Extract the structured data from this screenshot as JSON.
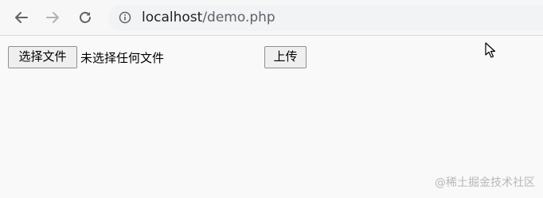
{
  "browser": {
    "address_bar": {
      "host": "localhost",
      "path": "/demo.php"
    },
    "icons": {
      "back": "arrow-left-icon",
      "forward": "arrow-right-icon",
      "reload": "reload-icon",
      "site_info": "info-icon"
    }
  },
  "form": {
    "choose_file_label": "选择文件",
    "file_status": "未选择任何文件",
    "upload_label": "上传"
  },
  "watermark": "@稀土掘金技术社区"
}
